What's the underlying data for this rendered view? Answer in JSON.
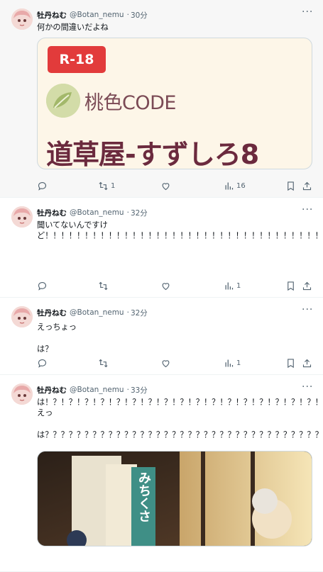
{
  "tweets": [
    {
      "name": "牡丹ねむ",
      "handle": "@Botan_nemu",
      "sep": "·",
      "time": "30分",
      "text": "何かの間違いだよね",
      "card": {
        "badge": "R-18",
        "brand": "桃色CODE",
        "store": "道草屋-すずしろ8"
      },
      "replies": "",
      "retweets": "1",
      "likes": "",
      "views": "16"
    },
    {
      "name": "牡丹ねむ",
      "handle": "@Botan_nemu",
      "sep": "·",
      "time": "32分",
      "text": "聞いてないんですけど！！！！！！！！！！！！！！！！！！！！！！！！！！！！！！！！！！！！！！！！！！！！！！！！！！！！！！！！！！！！！！！？？？？？？？？？？？？？？？？？？？？？？？？？？？？？？？？？？？？？？？？？？？？？？？？？？？？？？？？？？？",
      "replies": "",
      "retweets": "",
      "likes": "",
      "views": "1"
    },
    {
      "name": "牡丹ねむ",
      "handle": "@Botan_nemu",
      "sep": "·",
      "time": "32分",
      "text": "えっちょっ\n\nは？",
      "replies": "",
      "retweets": "",
      "likes": "",
      "views": "1"
    },
    {
      "name": "牡丹ねむ",
      "handle": "@Botan_nemu",
      "sep": "·",
      "time": "33分",
      "text": "は！？！？！？！？！？！？！？！？！？！？！？！？！？！？！？！？！？！？！？！？！？！？！？！？！？！？！？！？\nえっ\n\nは？？？？？？？？？？？？？？？？？？？？？？？？？？？？？？？？？？？？？？？？？？？？？？？？？？？？？？？？？？？？？？？？？？？？？？？？？",
      "image_caption": "みちくさ"
    }
  ],
  "icons": {
    "reply": "reply-icon",
    "retweet": "retweet-icon",
    "like": "heart-icon",
    "views": "views-icon",
    "bookmark": "bookmark-icon",
    "share": "share-icon",
    "more": "more-icon"
  },
  "colors": {
    "badge": "#e23b3b",
    "brand_text": "#7b4a55",
    "store_text": "#6b2a3e",
    "secondary": "#536471"
  }
}
